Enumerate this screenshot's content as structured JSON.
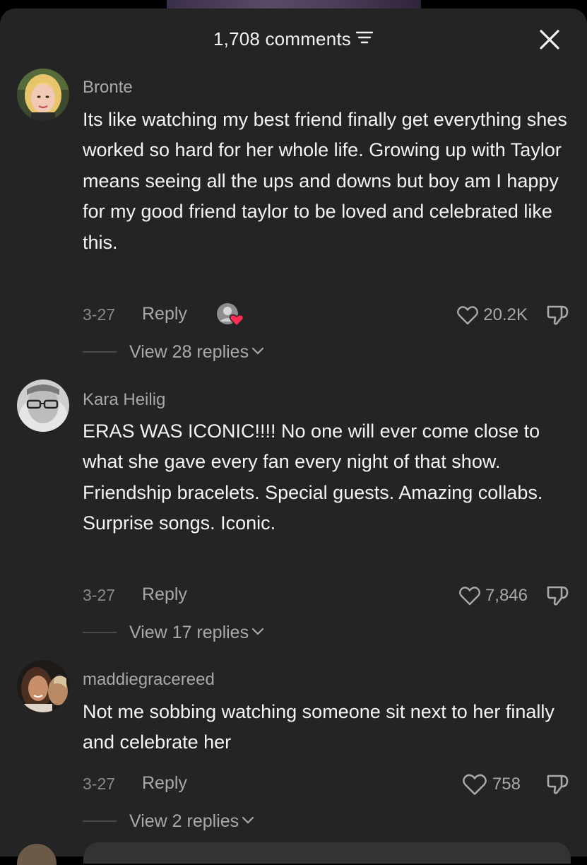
{
  "header": {
    "title": "1,708 comments",
    "sort_icon": "sort-icon",
    "close_icon": "close-icon"
  },
  "comments": [
    {
      "username": "Bronte",
      "text": "Its like watching my best friend finally get everything shes worked so hard for her whole life. Growing up with Taylor means seeing all the ups and downs but boy am I happy for my good friend taylor to be loved and celebrated like this.",
      "date": "3-27",
      "reply_label": "Reply",
      "likes": "20.2K",
      "view_replies": "View 28 replies",
      "creator_liked": true
    },
    {
      "username": "Kara Heilig",
      "text": "ERAS WAS ICONIC!!!! No one will ever come close to what she gave every fan every night of that show. Friendship bracelets. Special guests. Amazing collabs. Surprise songs. Iconic.",
      "date": "3-27",
      "reply_label": "Reply",
      "likes": "7,846",
      "view_replies": "View 17 replies",
      "creator_liked": false
    },
    {
      "username": "maddiegracereed",
      "text": "Not me sobbing watching someone sit next to her finally and celebrate her",
      "date": "3-27",
      "reply_label": "Reply",
      "likes": "758",
      "view_replies": "View 2 replies",
      "creator_liked": false
    }
  ],
  "colors": {
    "sheet_bg": "#242424",
    "text_primary": "#f4f4f4",
    "text_secondary": "#a9a9a9",
    "creator_heart": "#fe2c55"
  }
}
